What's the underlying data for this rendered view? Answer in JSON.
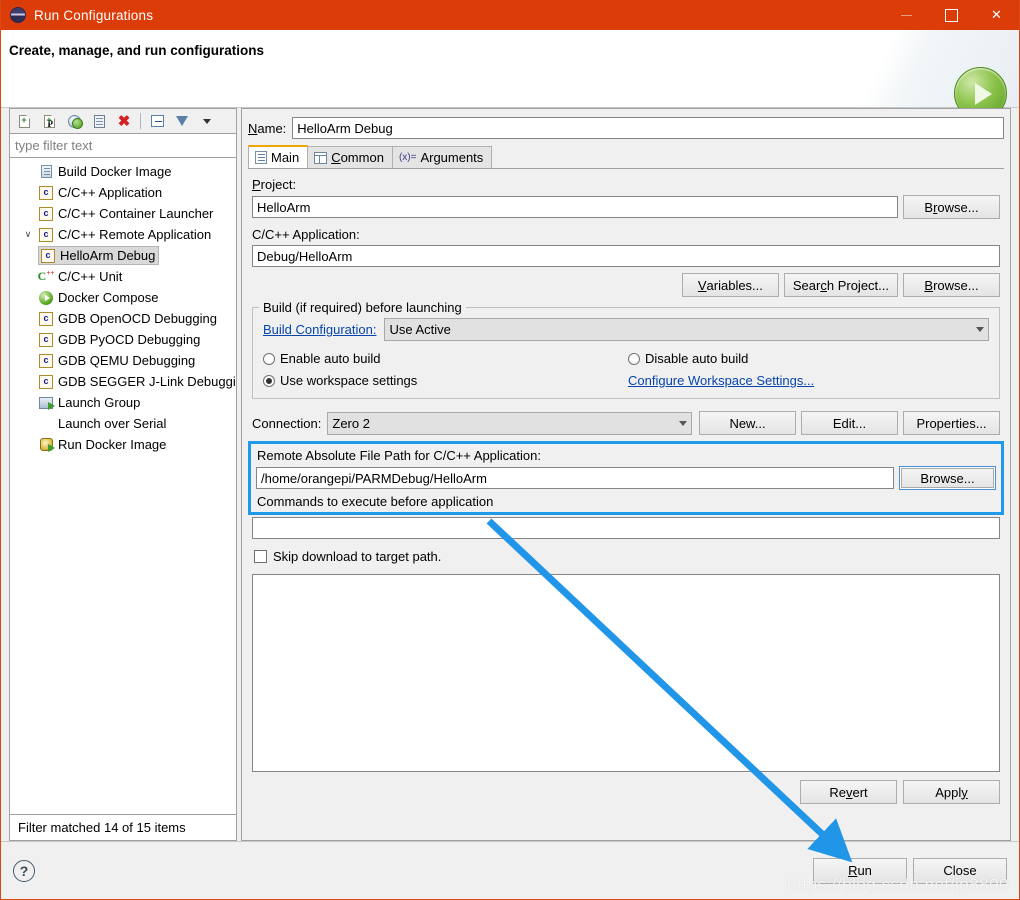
{
  "window": {
    "title": "Run Configurations",
    "app_icon": "eclipse-icon",
    "minimize": "–",
    "maximize": "□",
    "close": "✕",
    "titlebar_color": "#dc3c08"
  },
  "banner": {
    "title": "Create, manage, and run configurations",
    "icon": "run-play-icon"
  },
  "left_panel": {
    "toolbar": [
      {
        "name": "new-launch-configuration-icon",
        "label": "New launch configuration"
      },
      {
        "name": "new-prototype-icon",
        "label": "New prototype"
      },
      {
        "name": "export-launch-configuration-icon",
        "label": "Export"
      },
      {
        "name": "duplicate-icon",
        "label": "Duplicate"
      },
      {
        "name": "delete-icon",
        "label": "Delete"
      },
      {
        "name": "collapse-all-icon",
        "label": "Collapse All"
      },
      {
        "name": "filter-icon",
        "label": "Filter"
      },
      {
        "name": "view-menu-icon",
        "label": "View Menu"
      }
    ],
    "filter_placeholder": "type filter text",
    "filter_value": "",
    "tree": [
      {
        "label": "Build Docker Image",
        "icon": "build-docker-image-icon",
        "depth": 0,
        "twisty": "",
        "selected": false
      },
      {
        "label": "C/C++ Application",
        "icon": "c-config-icon",
        "depth": 0,
        "twisty": "",
        "selected": false
      },
      {
        "label": "C/C++ Container Launcher",
        "icon": "c-config-icon",
        "depth": 0,
        "twisty": "",
        "selected": false
      },
      {
        "label": "C/C++ Remote Application",
        "icon": "c-config-icon",
        "depth": 0,
        "twisty": "∨",
        "selected": false
      },
      {
        "label": "HelloArm Debug",
        "icon": "c-config-icon",
        "depth": 1,
        "twisty": "",
        "selected": true
      },
      {
        "label": "C/C++ Unit",
        "icon": "c-unit-icon",
        "depth": 0,
        "twisty": "",
        "selected": false
      },
      {
        "label": "Docker Compose",
        "icon": "docker-compose-icon",
        "depth": 0,
        "twisty": "",
        "selected": false
      },
      {
        "label": "GDB OpenOCD Debugging",
        "icon": "c-config-icon",
        "depth": 0,
        "twisty": "",
        "selected": false
      },
      {
        "label": "GDB PyOCD Debugging",
        "icon": "c-config-icon",
        "depth": 0,
        "twisty": "",
        "selected": false
      },
      {
        "label": "GDB QEMU Debugging",
        "icon": "c-config-icon",
        "depth": 0,
        "twisty": "",
        "selected": false
      },
      {
        "label": "GDB SEGGER J-Link Debugging",
        "icon": "c-config-icon",
        "depth": 0,
        "twisty": "",
        "selected": false
      },
      {
        "label": "Launch Group",
        "icon": "launch-group-icon",
        "depth": 0,
        "twisty": "",
        "selected": false
      },
      {
        "label": "Launch over Serial",
        "icon": "none",
        "depth": 0,
        "twisty": "",
        "selected": false
      },
      {
        "label": "Run Docker Image",
        "icon": "run-docker-image-icon",
        "depth": 0,
        "twisty": "",
        "selected": false
      }
    ],
    "filter_status": "Filter matched 14 of 15 items"
  },
  "right_panel": {
    "name_label": "Name:",
    "name_value": "HelloArm Debug",
    "tabs": [
      {
        "label": "Main",
        "icon": "main-tab-icon",
        "active": true
      },
      {
        "label": "Common",
        "icon": "common-tab-icon",
        "active": false
      },
      {
        "label": "Arguments",
        "icon": "arguments-tab-icon",
        "active": false
      }
    ],
    "project_label": "Project:",
    "project_value": "HelloArm",
    "application_label": "C/C++ Application:",
    "application_value": "Debug/HelloArm",
    "app_buttons": [
      "Variables...",
      "Search Project...",
      "Browse..."
    ],
    "build_group": {
      "title": "Build (if required) before launching",
      "build_configuration_label": "Build Configuration:",
      "build_configuration_value": "Use Active",
      "enable_auto_build": "Enable auto build",
      "disable_auto_build": "Disable auto build",
      "use_workspace_settings": "Use workspace settings",
      "configure_workspace_link": "Configure Workspace Settings...",
      "selected_radio": "use_workspace_settings"
    },
    "connection_label": "Connection:",
    "connection_value": "Zero 2",
    "connection_buttons": [
      "New...",
      "Edit...",
      "Properties..."
    ],
    "remote_path_label": "Remote Absolute File Path for C/C++ Application:",
    "remote_path_value": "/home/orangepi/PARMDebug/HelloArm",
    "remote_browse_label": "Browse...",
    "commands_label": "Commands to execute before application",
    "commands_value": "",
    "skip_download_label": "Skip download to target path.",
    "skip_download_checked": false,
    "revert_label": "Revert",
    "apply_label": "Apply"
  },
  "footer": {
    "help_icon": "help-icon",
    "run_label": "Run",
    "close_label": "Close"
  },
  "annotations": {
    "highlight_color": "#1e9ae8",
    "arrow_color": "#2196e8",
    "watermark": "https://blog.csdn.net/jp8800"
  }
}
